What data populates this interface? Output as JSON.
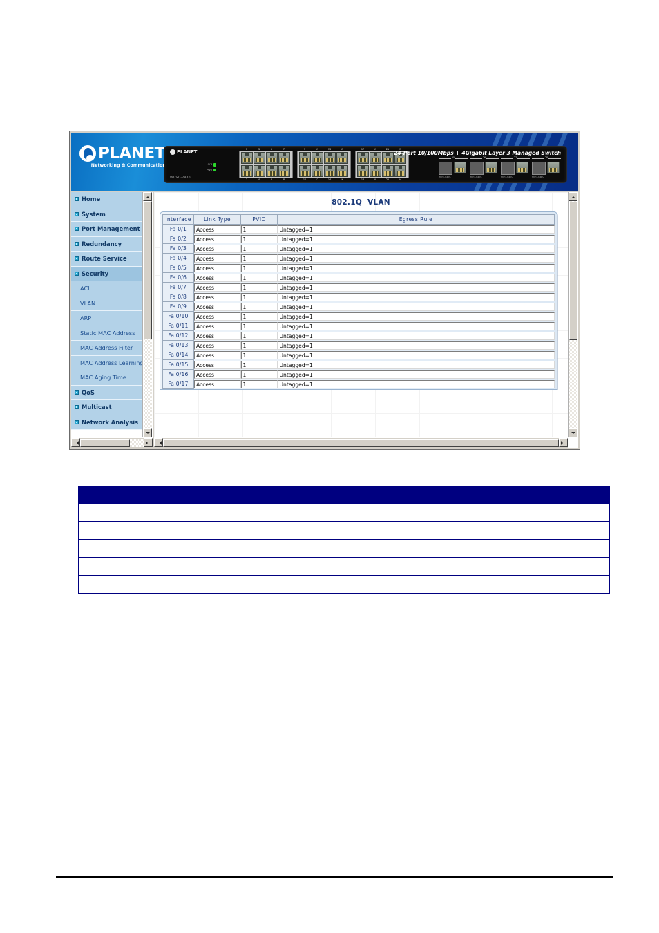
{
  "banner": {
    "logo_word": "PLANET",
    "logo_tagline": "Networking & Communication",
    "device_brand": "PLANET",
    "device_model": "WGSD-2840",
    "device_title": "24-Port 10/100Mbps + 4Gigabit Layer 3 Managed Switch",
    "leds": [
      {
        "label": "SYS"
      },
      {
        "label": "PWR"
      }
    ],
    "port_bank_top_numbers": [
      [
        "1",
        "3",
        "5",
        "7"
      ],
      [
        "9",
        "11",
        "13",
        "15"
      ],
      [
        "17",
        "19",
        "21",
        "23"
      ]
    ],
    "port_bank_bottom_numbers": [
      [
        "2",
        "4",
        "6",
        "8"
      ],
      [
        "10",
        "12",
        "14",
        "16"
      ],
      [
        "18",
        "20",
        "22",
        "24"
      ]
    ],
    "gbic_groups": [
      {
        "number": "25",
        "caption": "mini-GBIC"
      },
      {
        "number": "26",
        "caption": "mini-GBIC"
      },
      {
        "number": "27",
        "caption": "mini-GBIC"
      },
      {
        "number": "28",
        "caption": "mini-GBIC"
      }
    ]
  },
  "sidebar": {
    "items": [
      {
        "label": "Home",
        "type": "top",
        "active": false
      },
      {
        "label": "System",
        "type": "top",
        "active": false
      },
      {
        "label": "Port Management",
        "type": "top",
        "active": false
      },
      {
        "label": "Redundancy",
        "type": "top",
        "active": false
      },
      {
        "label": "Route Service",
        "type": "top",
        "active": false
      },
      {
        "label": "Security",
        "type": "top",
        "active": true
      },
      {
        "label": "ACL",
        "type": "sub",
        "active": false
      },
      {
        "label": "VLAN",
        "type": "sub",
        "active": false
      },
      {
        "label": "ARP",
        "type": "sub",
        "active": false
      },
      {
        "label": "Static MAC Address",
        "type": "sub",
        "active": false
      },
      {
        "label": "MAC Address Filter",
        "type": "sub",
        "active": false
      },
      {
        "label": "MAC Address Learning",
        "type": "sub",
        "active": false
      },
      {
        "label": "MAC Aging Time",
        "type": "sub",
        "active": false
      },
      {
        "label": "QoS",
        "type": "top",
        "active": false
      },
      {
        "label": "Multicast",
        "type": "top",
        "active": false
      },
      {
        "label": "Network Analysis",
        "type": "top",
        "active": false
      }
    ]
  },
  "content": {
    "page_title": "802.1Q  VLAN",
    "table": {
      "headers": [
        "Interface",
        "Link Type",
        "PVID",
        "Egress Rule"
      ],
      "rows": [
        {
          "interface": "Fa 0/1",
          "link_type": "Access",
          "pvid": "1",
          "egress_rule": "Untagged=1"
        },
        {
          "interface": "Fa 0/2",
          "link_type": "Access",
          "pvid": "1",
          "egress_rule": "Untagged=1"
        },
        {
          "interface": "Fa 0/3",
          "link_type": "Access",
          "pvid": "1",
          "egress_rule": "Untagged=1"
        },
        {
          "interface": "Fa 0/4",
          "link_type": "Access",
          "pvid": "1",
          "egress_rule": "Untagged=1"
        },
        {
          "interface": "Fa 0/5",
          "link_type": "Access",
          "pvid": "1",
          "egress_rule": "Untagged=1"
        },
        {
          "interface": "Fa 0/6",
          "link_type": "Access",
          "pvid": "1",
          "egress_rule": "Untagged=1"
        },
        {
          "interface": "Fa 0/7",
          "link_type": "Access",
          "pvid": "1",
          "egress_rule": "Untagged=1"
        },
        {
          "interface": "Fa 0/8",
          "link_type": "Access",
          "pvid": "1",
          "egress_rule": "Untagged=1"
        },
        {
          "interface": "Fa 0/9",
          "link_type": "Access",
          "pvid": "1",
          "egress_rule": "Untagged=1"
        },
        {
          "interface": "Fa 0/10",
          "link_type": "Access",
          "pvid": "1",
          "egress_rule": "Untagged=1"
        },
        {
          "interface": "Fa 0/11",
          "link_type": "Access",
          "pvid": "1",
          "egress_rule": "Untagged=1"
        },
        {
          "interface": "Fa 0/12",
          "link_type": "Access",
          "pvid": "1",
          "egress_rule": "Untagged=1"
        },
        {
          "interface": "Fa 0/13",
          "link_type": "Access",
          "pvid": "1",
          "egress_rule": "Untagged=1"
        },
        {
          "interface": "Fa 0/14",
          "link_type": "Access",
          "pvid": "1",
          "egress_rule": "Untagged=1"
        },
        {
          "interface": "Fa 0/15",
          "link_type": "Access",
          "pvid": "1",
          "egress_rule": "Untagged=1"
        },
        {
          "interface": "Fa 0/16",
          "link_type": "Access",
          "pvid": "1",
          "egress_rule": "Untagged=1"
        },
        {
          "interface": "Fa 0/17",
          "link_type": "Access",
          "pvid": "1",
          "egress_rule": "Untagged=1"
        }
      ]
    }
  },
  "param_table": {
    "header": [
      "",
      ""
    ],
    "rows": [
      [
        "",
        ""
      ],
      [
        "",
        ""
      ],
      [
        "",
        ""
      ],
      [
        "",
        ""
      ],
      [
        "",
        ""
      ]
    ]
  },
  "colors": {
    "navy": "#000080",
    "sidebar_blue": "#b3d2e8",
    "title_blue": "#1b3a7a"
  }
}
